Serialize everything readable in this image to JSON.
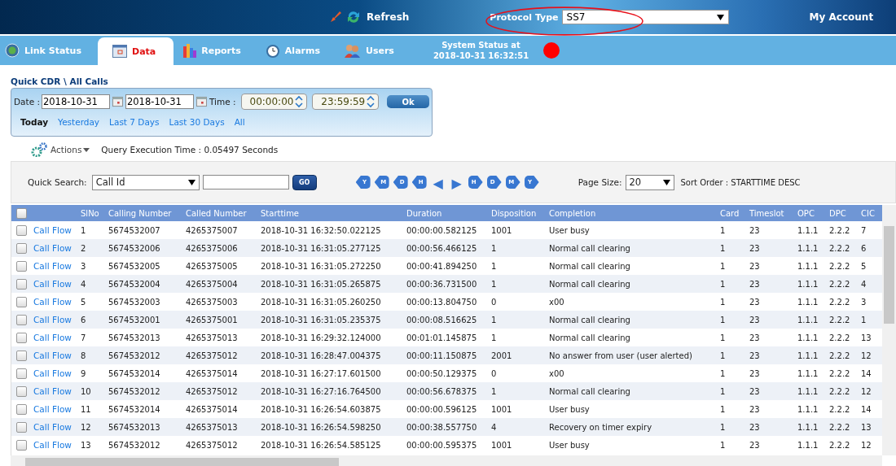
{
  "header": {
    "refresh": "Refresh",
    "protocol": {
      "label": "Protocol Type",
      "value": "SS7"
    },
    "my_account": "My Account"
  },
  "tabs": [
    {
      "label": "Link Status",
      "selected": false
    },
    {
      "label": "Data",
      "selected": true
    },
    {
      "label": "Reports",
      "selected": false
    },
    {
      "label": "Alarms",
      "selected": false
    },
    {
      "label": "Users",
      "selected": false
    }
  ],
  "system_status": {
    "label": "System Status at",
    "time": "2018-10-31 16:32:51",
    "color": "#ff0000"
  },
  "breadcrumb": "Quick CDR \\ All Calls",
  "filter": {
    "date_label": "Date :",
    "date_from": "2018-10-31",
    "date_to": "2018-10-31",
    "time_label": "Time :",
    "time_from": "00:00:00",
    "time_to": "23:59:59",
    "ok": "Ok",
    "ranges": [
      {
        "label": "Today",
        "selected": true
      },
      {
        "label": "Yesterday",
        "selected": false
      },
      {
        "label": "Last 7 Days",
        "selected": false
      },
      {
        "label": "Last 30 Days",
        "selected": false
      },
      {
        "label": "All",
        "selected": false
      }
    ]
  },
  "actions": "Actions",
  "query_time": "Query Execution Time : 0.05497 Seconds",
  "search": {
    "label": "Quick Search:",
    "field": "Call Id",
    "go": "GO",
    "pager": [
      {
        "label": "Y",
        "kind": "back"
      },
      {
        "label": "M",
        "kind": "back"
      },
      {
        "label": "D",
        "kind": "back"
      },
      {
        "label": "H",
        "kind": "back"
      },
      {
        "label": "◀",
        "kind": "prev"
      },
      {
        "label": "▶",
        "kind": "next"
      },
      {
        "label": "H",
        "kind": "fwd"
      },
      {
        "label": "D",
        "kind": "fwd"
      },
      {
        "label": "M",
        "kind": "fwd"
      },
      {
        "label": "Y",
        "kind": "fwd"
      }
    ],
    "page_size_label": "Page Size:",
    "page_size": "20",
    "sort": "Sort Order : STARTTIME DESC"
  },
  "table": {
    "header_checked": false,
    "columns": [
      "SlNo",
      "Calling Number",
      "Called Number",
      "Starttime",
      "Duration",
      "Disposition",
      "Completion",
      "Card",
      "Timeslot",
      "OPC",
      "DPC",
      "CIC"
    ],
    "rows": [
      {
        "checked": false,
        "link": "Call Flow",
        "cells": [
          "1",
          "5674532007",
          "4265375007",
          "2018-10-31 16:32:50.022125",
          "00:00:00.582125",
          "1001",
          "User busy",
          "1",
          "23",
          "1.1.1",
          "2.2.2",
          "7"
        ]
      },
      {
        "checked": false,
        "link": "Call Flow",
        "cells": [
          "2",
          "5674532006",
          "4265375006",
          "2018-10-31 16:31:05.277125",
          "00:00:56.466125",
          "1",
          "Normal call clearing",
          "1",
          "23",
          "1.1.1",
          "2.2.2",
          "6"
        ]
      },
      {
        "checked": false,
        "link": "Call Flow",
        "cells": [
          "3",
          "5674532005",
          "4265375005",
          "2018-10-31 16:31:05.272250",
          "00:00:41.894250",
          "1",
          "Normal call clearing",
          "1",
          "23",
          "1.1.1",
          "2.2.2",
          "5"
        ]
      },
      {
        "checked": false,
        "link": "Call Flow",
        "cells": [
          "4",
          "5674532004",
          "4265375004",
          "2018-10-31 16:31:05.265875",
          "00:00:36.731500",
          "1",
          "Normal call clearing",
          "1",
          "23",
          "1.1.1",
          "2.2.2",
          "4"
        ]
      },
      {
        "checked": false,
        "link": "Call Flow",
        "cells": [
          "5",
          "5674532003",
          "4265375003",
          "2018-10-31 16:31:05.260250",
          "00:00:13.804750",
          "0",
          "x00",
          "1",
          "23",
          "1.1.1",
          "2.2.2",
          "3"
        ]
      },
      {
        "checked": false,
        "link": "Call Flow",
        "cells": [
          "6",
          "5674532001",
          "4265375001",
          "2018-10-31 16:31:05.235375",
          "00:00:08.516625",
          "1",
          "Normal call clearing",
          "1",
          "23",
          "1.1.1",
          "2.2.2",
          "1"
        ]
      },
      {
        "checked": false,
        "link": "Call Flow",
        "cells": [
          "7",
          "5674532013",
          "4265375013",
          "2018-10-31 16:29:32.124000",
          "00:01:01.145875",
          "1",
          "Normal call clearing",
          "1",
          "23",
          "1.1.1",
          "2.2.2",
          "13"
        ]
      },
      {
        "checked": false,
        "link": "Call Flow",
        "cells": [
          "8",
          "5674532012",
          "4265375012",
          "2018-10-31 16:28:47.004375",
          "00:00:11.150875",
          "2001",
          "No answer from user (user alerted)",
          "1",
          "23",
          "1.1.1",
          "2.2.2",
          "12"
        ]
      },
      {
        "checked": false,
        "link": "Call Flow",
        "cells": [
          "9",
          "5674532014",
          "4265375014",
          "2018-10-31 16:27:17.601500",
          "00:00:50.129375",
          "0",
          "x00",
          "1",
          "23",
          "1.1.1",
          "2.2.2",
          "14"
        ]
      },
      {
        "checked": false,
        "link": "Call Flow",
        "cells": [
          "10",
          "5674532012",
          "4265375012",
          "2018-10-31 16:27:16.764500",
          "00:00:56.678375",
          "1",
          "Normal call clearing",
          "1",
          "23",
          "1.1.1",
          "2.2.2",
          "12"
        ]
      },
      {
        "checked": false,
        "link": "Call Flow",
        "cells": [
          "11",
          "5674532014",
          "4265375014",
          "2018-10-31 16:26:54.603875",
          "00:00:00.596125",
          "1001",
          "User busy",
          "1",
          "23",
          "1.1.1",
          "2.2.2",
          "14"
        ]
      },
      {
        "checked": false,
        "link": "Call Flow",
        "cells": [
          "12",
          "5674532013",
          "4265375013",
          "2018-10-31 16:26:54.598250",
          "00:00:38.557750",
          "4",
          "Recovery on timer expiry",
          "1",
          "23",
          "1.1.1",
          "2.2.2",
          "13"
        ]
      },
      {
        "checked": false,
        "link": "Call Flow",
        "cells": [
          "13",
          "5674532012",
          "4265375012",
          "2018-10-31 16:26:54.585125",
          "00:00:00.595375",
          "1001",
          "User busy",
          "1",
          "23",
          "1.1.1",
          "2.2.2",
          "12"
        ]
      }
    ]
  }
}
